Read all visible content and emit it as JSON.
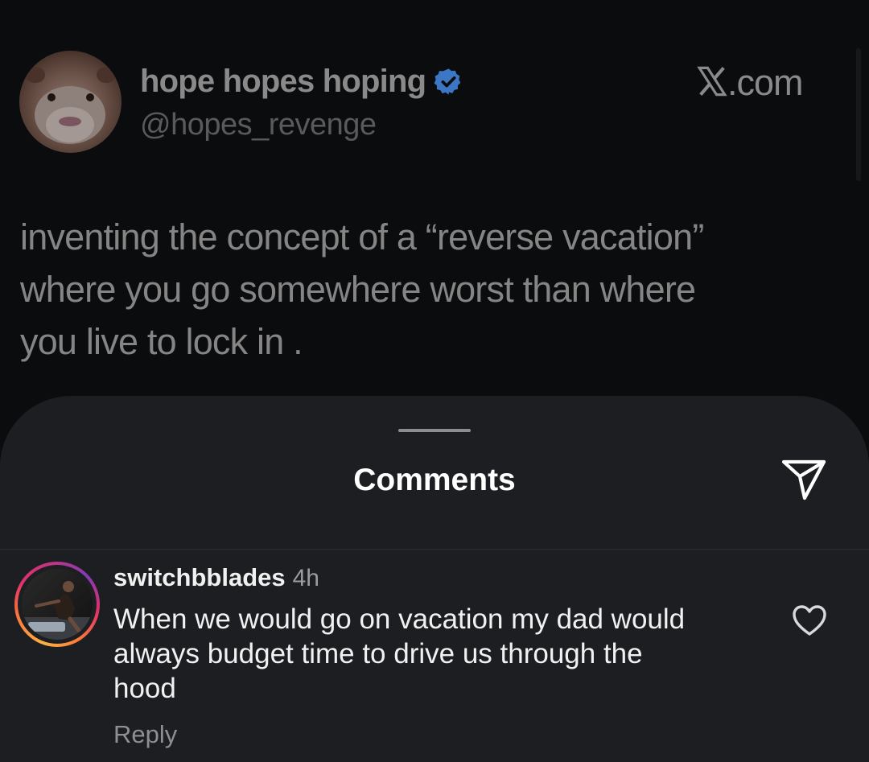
{
  "tweet": {
    "author_name": "hope hopes hoping",
    "author_handle": "@hopes_revenge",
    "site": ".com",
    "site_logo": "x-logo-icon",
    "verified_icon": "verified-badge-icon",
    "text": "inventing the  concept of a  “reverse vacation”\nwhere you  go  somewhere  worst than where\nyou  live   to  lock in  ."
  },
  "comments_sheet": {
    "title": "Comments",
    "share_icon": "send-icon",
    "items": [
      {
        "username": "switchbblades",
        "time": "4h",
        "text": "When we would go on vacation my dad would\nalways budget time to drive us through the\nhood",
        "reply_label": "Reply",
        "like_icon": "heart-outline-icon"
      }
    ]
  },
  "colors": {
    "background": "#0b0c0e",
    "sheet": "#1c1e22",
    "verified_blue": "#3b77c4",
    "story_ring": [
      "#fcb045",
      "#e1306c",
      "#833ab4"
    ]
  }
}
